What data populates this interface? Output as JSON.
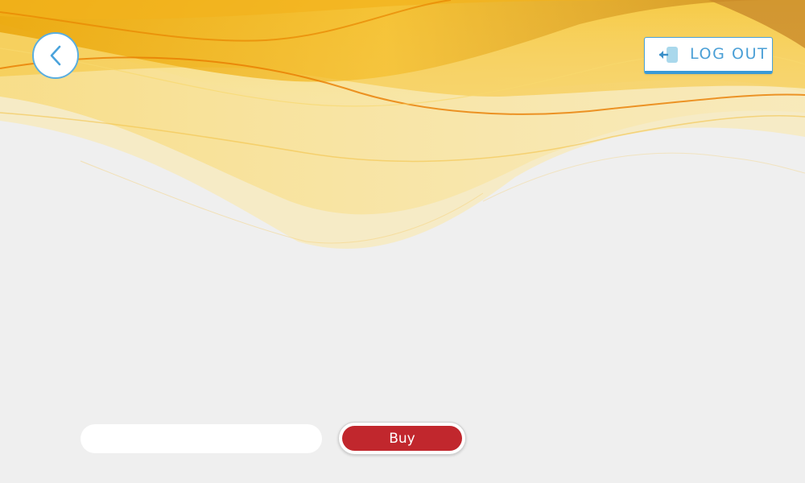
{
  "header": {
    "back_icon": "chevron-left-icon",
    "logout": {
      "label": "LOG OUT",
      "icon": "logout-door-icon"
    }
  },
  "purchase": {
    "input_value": "",
    "buy_label": "Buy"
  },
  "colors": {
    "background": "#efefef",
    "wave_orange": "#f0a500",
    "wave_yellow": "#f7d25a",
    "accent_blue": "#4a9fd6",
    "buy_red": "#c1272d"
  }
}
